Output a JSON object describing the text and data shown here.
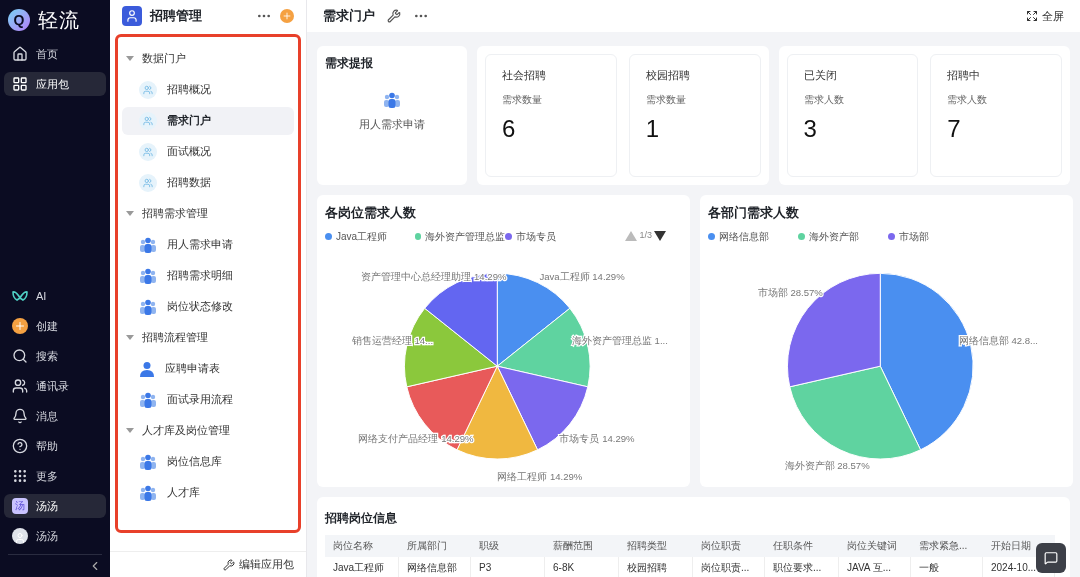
{
  "brand": {
    "name": "轻流",
    "logo_letter": "Q"
  },
  "nav": {
    "top": [
      {
        "label": "首页",
        "selected": false
      },
      {
        "label": "应用包",
        "selected": true
      }
    ],
    "bottom": [
      {
        "label": "AI",
        "selected": false
      },
      {
        "label": "创建",
        "selected": false
      },
      {
        "label": "搜索",
        "selected": false
      },
      {
        "label": "通讯录",
        "selected": false
      },
      {
        "label": "消息",
        "selected": false
      },
      {
        "label": "帮助",
        "selected": false
      },
      {
        "label": "更多",
        "selected": false
      },
      {
        "label": "汤汤",
        "tile": "汤",
        "selected": true
      },
      {
        "label": "汤汤",
        "selected": false
      }
    ]
  },
  "sidebar": {
    "title": "招聘管理",
    "groups": [
      {
        "label": "数据门户",
        "expanded": true,
        "children": [
          {
            "label": "招聘概况",
            "kind": "dashboard",
            "selected": false
          },
          {
            "label": "需求门户",
            "kind": "dashboard",
            "selected": true
          },
          {
            "label": "面试概况",
            "kind": "dashboard",
            "selected": false
          },
          {
            "label": "招聘数据",
            "kind": "dashboard",
            "selected": false
          }
        ]
      },
      {
        "label": "招聘需求管理",
        "expanded": true,
        "children": [
          {
            "label": "用人需求申请",
            "kind": "form",
            "selected": false
          },
          {
            "label": "招聘需求明细",
            "kind": "form",
            "selected": false
          },
          {
            "label": "岗位状态修改",
            "kind": "form",
            "selected": false
          }
        ]
      },
      {
        "label": "招聘流程管理",
        "expanded": true,
        "children": [
          {
            "label": "应聘申请表",
            "kind": "public",
            "selected": false
          },
          {
            "label": "面试录用流程",
            "kind": "form",
            "selected": false
          }
        ]
      },
      {
        "label": "人才库及岗位管理",
        "expanded": true,
        "children": [
          {
            "label": "岗位信息库",
            "kind": "form",
            "selected": false
          },
          {
            "label": "人才库",
            "kind": "form",
            "selected": false
          }
        ]
      }
    ],
    "footer": "编辑应用包"
  },
  "page": {
    "title": "需求门户",
    "fullscreen": "全屏"
  },
  "report": {
    "title": "需求提报",
    "action": "用人需求申请"
  },
  "stat_groups": [
    [
      {
        "title": "社会招聘",
        "label": "需求数量",
        "value": "6"
      },
      {
        "title": "校园招聘",
        "label": "需求数量",
        "value": "1"
      }
    ],
    [
      {
        "title": "已关闭",
        "label": "需求人数",
        "value": "3"
      },
      {
        "title": "招聘中",
        "label": "需求人数",
        "value": "7"
      }
    ]
  ],
  "charts": [
    {
      "legend": [
        {
          "label": "Java工程师",
          "color": "#4a8ff0"
        },
        {
          "label": "海外资产管理总监",
          "color": "#5fd3a0"
        },
        {
          "label": "市场专员",
          "color": "#7b68ee"
        }
      ],
      "legend_page": "1/3",
      "slice_labels": [
        "资产管理中心总经理助理 14.29%",
        "Java工程师 14.29%",
        "销售运营经理 14...",
        "海外资产管理总监 1...",
        "网络支付产品经理 14.29%",
        "市场专员 14.29%",
        "网络工程师 14.29%"
      ],
      "chart_data": {
        "type": "pie",
        "title": "各岗位需求人数",
        "values": [
          14.29,
          14.29,
          14.29,
          14.29,
          14.29,
          14.29,
          14.29
        ]
      }
    },
    {
      "legend": [
        {
          "label": "网络信息部",
          "color": "#4a8ff0"
        },
        {
          "label": "海外资产部",
          "color": "#5fd3a0"
        },
        {
          "label": "市场部",
          "color": "#7b68ee"
        }
      ],
      "slice_labels": [
        "市场部 28.57%",
        "网络信息部 42.8...",
        "海外资产部 28.57%"
      ],
      "chart_data": {
        "type": "pie",
        "title": "各部门需求人数",
        "values": [
          42.86,
          28.57,
          28.57
        ]
      }
    }
  ],
  "table": {
    "title": "招聘岗位信息",
    "columns": [
      "岗位名称",
      "所属部门",
      "职级",
      "薪酬范围",
      "招聘类型",
      "岗位职责",
      "任职条件",
      "岗位关键词",
      "需求紧急...",
      "开始日期"
    ],
    "rows": [
      [
        "Java工程师",
        "网络信息部",
        "P3",
        "6-8K",
        "校园招聘",
        "岗位职责...",
        "职位要求...",
        "JAVA 互...",
        "一般",
        "2024-10..."
      ]
    ]
  }
}
